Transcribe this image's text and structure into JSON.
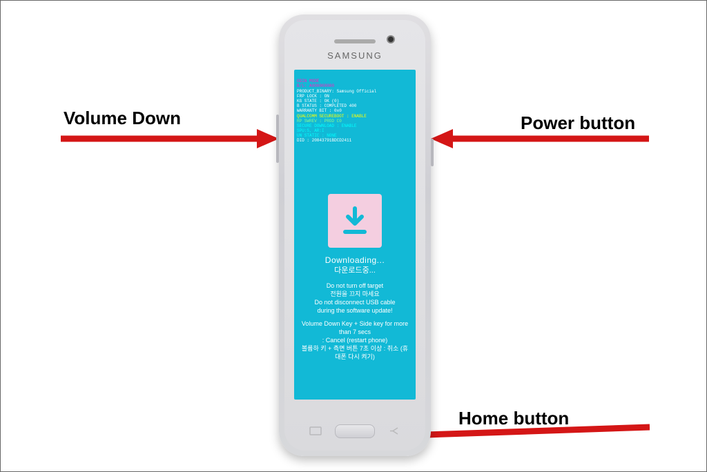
{
  "labels": {
    "volume_down": "Volume Down",
    "power_button": "Power button",
    "home_button": "Home button"
  },
  "colors": {
    "arrow": "#d41616",
    "screen_bg": "#12b9d6",
    "icon_bg": "#f4cee0",
    "icon_fg": "#12b9d6"
  },
  "phone": {
    "brand": "SAMSUNG"
  },
  "debug": {
    "l1": "ODIN MODE",
    "l2": "B/L: A000000000",
    "l3": "PRODUCT_BINARY: Samsung Official",
    "l4": "FRP LOCK : ON",
    "l5": "KG STATE : OK (0)",
    "l6": "B STATUS : COMPLETED 400",
    "l7": "WARRANTY BIT : 0x0",
    "l8": "QUALCOMM SECUREBOOT : ENABLE",
    "l9": "RP SWREV : PROD C0",
    "l10": "SECURE DOWNLOAD : ENABLE",
    "l11": "DID : 20843791BDCD2411",
    "l12": "SPU:S, AR:I",
    "l13": "UN STATIC : NONE"
  },
  "download": {
    "title": "Downloading...",
    "title_kr": "다운로드중...",
    "warn1": "Do not turn off target",
    "warn1_kr": "전원을 끄지 마세요",
    "warn2a": "Do not disconnect USB cable",
    "warn2b": "during the software update!",
    "cancel1": "Volume Down Key + Side key for more than 7 secs",
    "cancel2": ": Cancel (restart phone)",
    "cancel_kr": "볼륨하 키 + 측면 버튼 7초 이상 : 취소 (휴대폰 다시 켜기)"
  }
}
